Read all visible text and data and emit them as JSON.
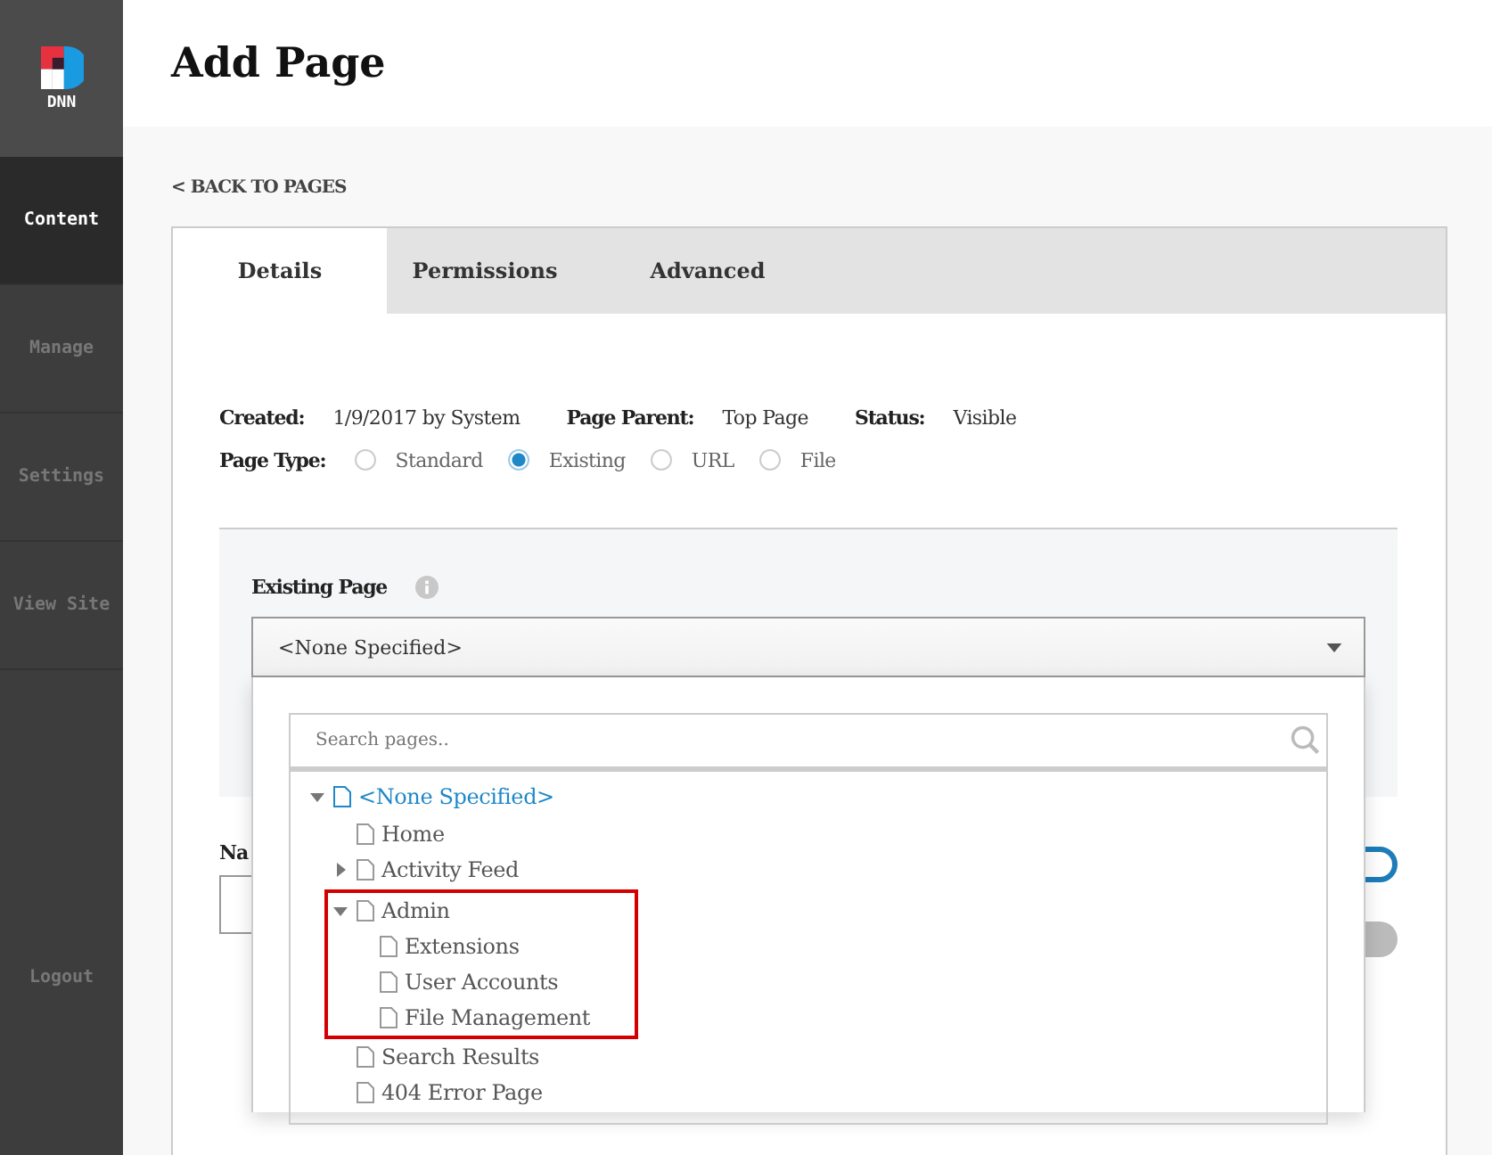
{
  "sidebar": {
    "logo_text": "DNN",
    "items": [
      {
        "label": "Content",
        "selected": true
      },
      {
        "label": "Manage",
        "selected": false
      },
      {
        "label": "Settings",
        "selected": false
      },
      {
        "label": "View Site",
        "selected": false
      }
    ],
    "logout": "Logout"
  },
  "page_title": "Add Page",
  "back_link": "< BACK TO PAGES",
  "tabs": [
    {
      "label": "Details",
      "selected": true
    },
    {
      "label": "Permissions",
      "selected": false
    },
    {
      "label": "Advanced",
      "selected": false
    }
  ],
  "info": [
    {
      "label": "Created:",
      "value": "1/9/2017 by System"
    },
    {
      "label": "Page Parent:",
      "value": "Top Page"
    },
    {
      "label": "Status:",
      "value": "Visible"
    }
  ],
  "page_type": {
    "label": "Page Type:",
    "options": [
      {
        "label": "Standard",
        "selected": false
      },
      {
        "label": "Existing",
        "selected": true
      },
      {
        "label": "URL",
        "selected": false
      },
      {
        "label": "File",
        "selected": false
      }
    ]
  },
  "existing_page": {
    "label": "Existing Page",
    "value": "<None Specified>",
    "search_placeholder": "Search pages..",
    "tree": [
      {
        "label": "<None Specified>",
        "selected": true,
        "expanded": true,
        "highlighted": false,
        "children": [
          {
            "label": "Home",
            "selected": false,
            "highlighted": false
          },
          {
            "label": "Activity Feed",
            "selected": false,
            "expanded": false,
            "highlighted": false
          },
          {
            "label": "Admin",
            "selected": false,
            "expanded": true,
            "highlighted": true,
            "children": [
              {
                "label": "Extensions",
                "selected": false,
                "highlighted": false
              },
              {
                "label": "User Accounts",
                "selected": false,
                "highlighted": false
              },
              {
                "label": "File Management",
                "selected": false,
                "highlighted": false
              }
            ]
          },
          {
            "label": "Search Results",
            "selected": false,
            "highlighted": false
          },
          {
            "label": "404 Error Page",
            "selected": false,
            "highlighted": false
          }
        ]
      }
    ]
  },
  "name_label": "Na",
  "toggles": [
    {
      "on": true
    },
    {
      "on": false
    }
  ]
}
